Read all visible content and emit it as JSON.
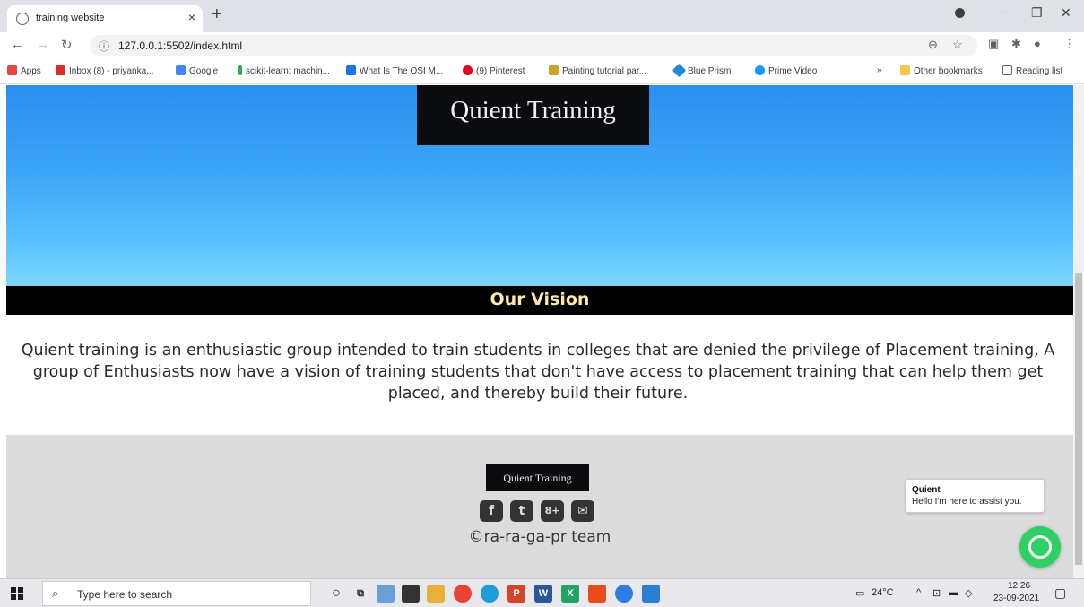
{
  "browser": {
    "tab_title": "training website",
    "tab_close": "×",
    "new_tab": "+",
    "url": "127.0.0.1:5502/index.html",
    "window_controls": [
      "−",
      "❐",
      "✕"
    ]
  },
  "bookmarks": {
    "items": [
      {
        "label": "Apps",
        "color": "#e8453c"
      },
      {
        "label": "Inbox (8) - priyanka...",
        "color": "#d93025"
      },
      {
        "label": "Google",
        "color": "#4285f4"
      },
      {
        "label": "scikit-learn: machin...",
        "color": "#34a853"
      },
      {
        "label": "What Is The OSI M...",
        "color": "#1a73e8"
      },
      {
        "label": "(9) Pinterest",
        "color": "#e60023"
      },
      {
        "label": "Painting tutorial par...",
        "color": "#c9a227"
      },
      {
        "label": "Blue Prism",
        "color": "#1d8bd6"
      },
      {
        "label": "Prime Video",
        "color": "#1399ff"
      }
    ],
    "more": "»",
    "other": "Other bookmarks",
    "reading": "Reading list"
  },
  "page": {
    "brand": "Quient Training",
    "vision_heading": "Our Vision",
    "vision_text": "Quient training is an enthusiastic group intended to train students in colleges that are denied the privilege of Placement training, A group of Enthusiasts now have a vision of training students that don't have access to placement training that can help them get placed, and thereby build their future.",
    "footer_brand": "Quient Training",
    "social": [
      {
        "label": "f",
        "icon": "facebook-icon"
      },
      {
        "label": "t",
        "icon": "twitter-icon"
      },
      {
        "label": "8+",
        "icon": "google-plus-icon"
      },
      {
        "label": "✉",
        "icon": "mail-icon"
      }
    ],
    "copyright": "©ra-ra-ga-pr team",
    "chat": {
      "name": "Quient",
      "message": "Hello I'm here to assist you."
    }
  },
  "taskbar": {
    "search_placeholder": "Type here to search",
    "weather": "24°C",
    "time": "12:26",
    "date": "23-09-2021"
  }
}
